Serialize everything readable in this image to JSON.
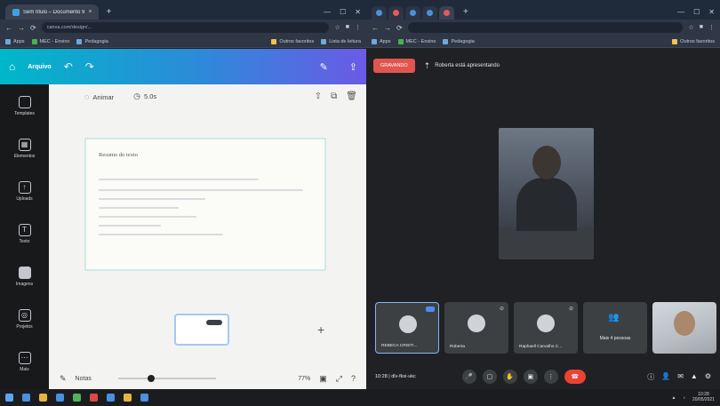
{
  "left_window": {
    "tab_title": "Sem título – Documento 9",
    "tab_close": "×",
    "new_tab": "+",
    "omnibox": "canva.com/design/...",
    "bookmarks": [
      "Apps",
      "MEC - Ensino",
      "Pedagogia"
    ],
    "bookmarks_right": [
      "Outros favoritos",
      "Lista de leitura"
    ]
  },
  "canva": {
    "menu_label": "Arquivo",
    "sidebar": [
      {
        "label": "Templates",
        "icon": "template-icon"
      },
      {
        "label": "Elementos",
        "icon": "elements-icon"
      },
      {
        "label": "Uploads",
        "icon": "upload-icon"
      },
      {
        "label": "Texto",
        "icon": "text-icon"
      },
      {
        "label": "Imagens",
        "icon": "images-icon"
      },
      {
        "label": "Projetos",
        "icon": "projects-icon"
      },
      {
        "label": "Mais",
        "icon": "more-icon"
      }
    ],
    "animate_label": "Animar",
    "duration_label": "5.0s",
    "page_title": "Resumo do texto",
    "notes_label": "Notas",
    "zoom_label": "77%",
    "zoom_fraction": 0.3
  },
  "meet": {
    "rec_label": "GRAVANDO",
    "presenting_label": "Roberta está apresentando",
    "speaker_name": "",
    "tiles": [
      {
        "name": "REBECA CRISTI...",
        "self": true
      },
      {
        "name": "Roberta"
      },
      {
        "name": "Raphaell Carvalho C..."
      },
      {
        "name": "Mais 4 pessoas",
        "more": true
      },
      {
        "name": "",
        "camera": true
      }
    ],
    "time_label": "10:28 | dlv-fkxi-ukc"
  },
  "taskbar": {
    "time": "10:28",
    "date": "20/05/2021"
  }
}
